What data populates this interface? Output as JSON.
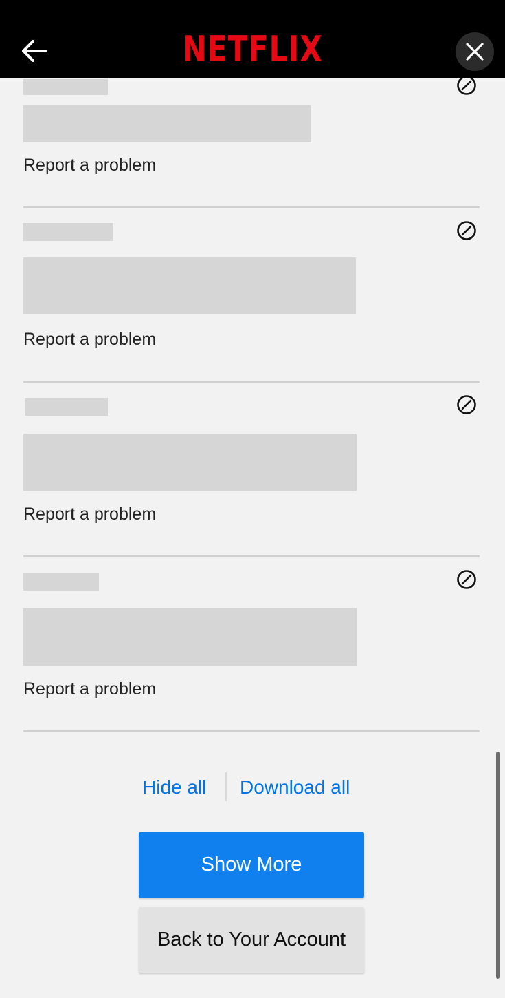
{
  "header": {
    "back_icon": "arrow-left-icon",
    "logo": "NETFLIX",
    "brand_color": "#e50914",
    "close_icon": "close-icon"
  },
  "entries": [
    {
      "report_label": "Report a problem",
      "hide_icon": "hide-circle-slash-icon"
    },
    {
      "report_label": "Report a problem",
      "hide_icon": "hide-circle-slash-icon"
    },
    {
      "report_label": "Report a problem",
      "hide_icon": "hide-circle-slash-icon"
    },
    {
      "report_label": "Report a problem",
      "hide_icon": "hide-circle-slash-icon"
    }
  ],
  "actions": {
    "hide_all": "Hide all",
    "download_all": "Download all",
    "link_color": "#0073e6"
  },
  "buttons": {
    "show_more": "Show More",
    "back_to_account": "Back to Your Account",
    "primary_color": "#0f80ee"
  }
}
